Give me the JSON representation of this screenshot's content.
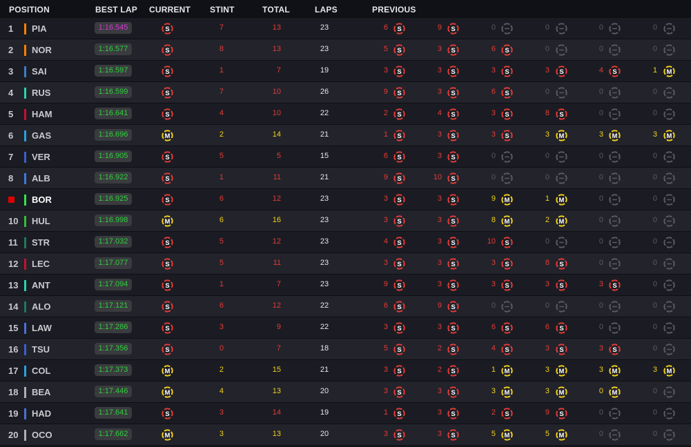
{
  "headers": {
    "position": "POSITION",
    "best_lap": "BEST LAP",
    "current": "CURRENT",
    "stint": "STINT",
    "total": "TOTAL",
    "laps": "LAPS",
    "previous": "PREVIOUS"
  },
  "colors": {
    "soft": "#e63b36",
    "medium": "#f3d21c",
    "none": "#5a5b62",
    "best_lap_green": "#2fd13d",
    "best_lap_purple": "#d13bd1",
    "player_marker": "#e00000"
  },
  "drivers": [
    {
      "pos": "1",
      "abbr": "PIA",
      "team_color": "#ff8000",
      "best": "1:16.545",
      "best_class": "purple",
      "current": "S",
      "stint": "7",
      "total": "13",
      "laps": "23",
      "prev": [
        [
          "6",
          "S"
        ],
        [
          "9",
          "S"
        ],
        [
          "0",
          "N"
        ],
        [
          "0",
          "N"
        ],
        [
          "0",
          "N"
        ],
        [
          "0",
          "N"
        ]
      ]
    },
    {
      "pos": "2",
      "abbr": "NOR",
      "team_color": "#ff8000",
      "best": "1:16.577",
      "best_class": "green",
      "current": "S",
      "stint": "8",
      "total": "13",
      "laps": "23",
      "prev": [
        [
          "5",
          "S"
        ],
        [
          "3",
          "S"
        ],
        [
          "6",
          "S"
        ],
        [
          "0",
          "N"
        ],
        [
          "0",
          "N"
        ],
        [
          "0",
          "N"
        ]
      ]
    },
    {
      "pos": "3",
      "abbr": "SAI",
      "team_color": "#3b7fc4",
      "best": "1:16.597",
      "best_class": "green",
      "current": "S",
      "stint": "1",
      "total": "7",
      "laps": "19",
      "prev": [
        [
          "3",
          "S"
        ],
        [
          "3",
          "S"
        ],
        [
          "3",
          "S"
        ],
        [
          "3",
          "S"
        ],
        [
          "4",
          "S"
        ],
        [
          "1",
          "M"
        ]
      ]
    },
    {
      "pos": "4",
      "abbr": "RUS",
      "team_color": "#27d6b0",
      "best": "1:16.599",
      "best_class": "green",
      "current": "S",
      "stint": "7",
      "total": "10",
      "laps": "26",
      "prev": [
        [
          "9",
          "S"
        ],
        [
          "3",
          "S"
        ],
        [
          "6",
          "S"
        ],
        [
          "0",
          "N"
        ],
        [
          "0",
          "N"
        ],
        [
          "0",
          "N"
        ]
      ]
    },
    {
      "pos": "5",
      "abbr": "HAM",
      "team_color": "#c8102e",
      "best": "1:16.641",
      "best_class": "green",
      "current": "S",
      "stint": "4",
      "total": "10",
      "laps": "22",
      "prev": [
        [
          "2",
          "S"
        ],
        [
          "4",
          "S"
        ],
        [
          "3",
          "S"
        ],
        [
          "8",
          "S"
        ],
        [
          "0",
          "N"
        ],
        [
          "0",
          "N"
        ]
      ]
    },
    {
      "pos": "6",
      "abbr": "GAS",
      "team_color": "#2aa1e0",
      "best": "1:16.696",
      "best_class": "green",
      "current": "M",
      "stint": "2",
      "total": "14",
      "laps": "21",
      "prev": [
        [
          "1",
          "S"
        ],
        [
          "3",
          "S"
        ],
        [
          "3",
          "S"
        ],
        [
          "3",
          "M"
        ],
        [
          "3",
          "M"
        ],
        [
          "3",
          "M"
        ]
      ]
    },
    {
      "pos": "7",
      "abbr": "VER",
      "team_color": "#3a5fcf",
      "best": "1:16.905",
      "best_class": "green",
      "current": "S",
      "stint": "5",
      "total": "5",
      "laps": "15",
      "prev": [
        [
          "6",
          "S"
        ],
        [
          "3",
          "S"
        ],
        [
          "0",
          "N"
        ],
        [
          "0",
          "N"
        ],
        [
          "0",
          "N"
        ],
        [
          "0",
          "N"
        ]
      ]
    },
    {
      "pos": "8",
      "abbr": "ALB",
      "team_color": "#3a7be0",
      "best": "1:16.922",
      "best_class": "green",
      "current": "S",
      "stint": "1",
      "total": "11",
      "laps": "21",
      "prev": [
        [
          "9",
          "S"
        ],
        [
          "10",
          "S"
        ],
        [
          "0",
          "N"
        ],
        [
          "0",
          "N"
        ],
        [
          "0",
          "N"
        ],
        [
          "0",
          "N"
        ]
      ]
    },
    {
      "pos": "9",
      "abbr": "BOR",
      "team_color": "#34e34a",
      "best": "1:16.925",
      "best_class": "green",
      "current": "S",
      "stint": "6",
      "total": "12",
      "laps": "23",
      "prev": [
        [
          "3",
          "S"
        ],
        [
          "3",
          "S"
        ],
        [
          "9",
          "M"
        ],
        [
          "1",
          "M"
        ],
        [
          "0",
          "N"
        ],
        [
          "0",
          "N"
        ]
      ],
      "player": true
    },
    {
      "pos": "10",
      "abbr": "HUL",
      "team_color": "#34c03a",
      "best": "1:16.998",
      "best_class": "green",
      "current": "M",
      "stint": "6",
      "total": "16",
      "laps": "23",
      "prev": [
        [
          "3",
          "S"
        ],
        [
          "3",
          "S"
        ],
        [
          "8",
          "M"
        ],
        [
          "2",
          "M"
        ],
        [
          "0",
          "N"
        ],
        [
          "0",
          "N"
        ]
      ]
    },
    {
      "pos": "11",
      "abbr": "STR",
      "team_color": "#1e7a5a",
      "best": "1:17.032",
      "best_class": "green",
      "current": "S",
      "stint": "5",
      "total": "12",
      "laps": "23",
      "prev": [
        [
          "4",
          "S"
        ],
        [
          "3",
          "S"
        ],
        [
          "10",
          "S"
        ],
        [
          "0",
          "N"
        ],
        [
          "0",
          "N"
        ],
        [
          "0",
          "N"
        ]
      ]
    },
    {
      "pos": "12",
      "abbr": "LEC",
      "team_color": "#c8102e",
      "best": "1:17.077",
      "best_class": "green",
      "current": "S",
      "stint": "5",
      "total": "11",
      "laps": "23",
      "prev": [
        [
          "3",
          "S"
        ],
        [
          "3",
          "S"
        ],
        [
          "3",
          "S"
        ],
        [
          "8",
          "S"
        ],
        [
          "0",
          "N"
        ],
        [
          "0",
          "N"
        ]
      ]
    },
    {
      "pos": "13",
      "abbr": "ANT",
      "team_color": "#27d6b0",
      "best": "1:17.094",
      "best_class": "green",
      "current": "S",
      "stint": "1",
      "total": "7",
      "laps": "23",
      "prev": [
        [
          "9",
          "S"
        ],
        [
          "3",
          "S"
        ],
        [
          "3",
          "S"
        ],
        [
          "3",
          "S"
        ],
        [
          "3",
          "S"
        ],
        [
          "0",
          "N"
        ]
      ]
    },
    {
      "pos": "14",
      "abbr": "ALO",
      "team_color": "#1e7a5a",
      "best": "1:17.121",
      "best_class": "green",
      "current": "S",
      "stint": "6",
      "total": "12",
      "laps": "22",
      "prev": [
        [
          "6",
          "S"
        ],
        [
          "9",
          "S"
        ],
        [
          "0",
          "N"
        ],
        [
          "0",
          "N"
        ],
        [
          "0",
          "N"
        ],
        [
          "0",
          "N"
        ]
      ]
    },
    {
      "pos": "15",
      "abbr": "LAW",
      "team_color": "#4a6fd6",
      "best": "1:17.286",
      "best_class": "green",
      "current": "S",
      "stint": "3",
      "total": "9",
      "laps": "22",
      "prev": [
        [
          "3",
          "S"
        ],
        [
          "3",
          "S"
        ],
        [
          "6",
          "S"
        ],
        [
          "6",
          "S"
        ],
        [
          "0",
          "N"
        ],
        [
          "0",
          "N"
        ]
      ]
    },
    {
      "pos": "16",
      "abbr": "TSU",
      "team_color": "#3a5fcf",
      "best": "1:17.356",
      "best_class": "green",
      "current": "S",
      "stint": "0",
      "total": "7",
      "laps": "18",
      "prev": [
        [
          "5",
          "S"
        ],
        [
          "2",
          "S"
        ],
        [
          "4",
          "S"
        ],
        [
          "3",
          "S"
        ],
        [
          "3",
          "S"
        ],
        [
          "0",
          "N"
        ]
      ]
    },
    {
      "pos": "17",
      "abbr": "COL",
      "team_color": "#2aa1e0",
      "best": "1:17.373",
      "best_class": "green",
      "current": "M",
      "stint": "2",
      "total": "15",
      "laps": "21",
      "prev": [
        [
          "3",
          "S"
        ],
        [
          "2",
          "S"
        ],
        [
          "1",
          "M"
        ],
        [
          "3",
          "M"
        ],
        [
          "3",
          "M"
        ],
        [
          "3",
          "M"
        ]
      ]
    },
    {
      "pos": "18",
      "abbr": "BEA",
      "team_color": "#b0b0b0",
      "best": "1:17.446",
      "best_class": "green",
      "current": "M",
      "stint": "4",
      "total": "13",
      "laps": "20",
      "prev": [
        [
          "3",
          "S"
        ],
        [
          "3",
          "S"
        ],
        [
          "3",
          "M"
        ],
        [
          "3",
          "M"
        ],
        [
          "0",
          "M"
        ],
        [
          "0",
          "N"
        ]
      ]
    },
    {
      "pos": "19",
      "abbr": "HAD",
      "team_color": "#4a6fd6",
      "best": "1:17.641",
      "best_class": "green",
      "current": "S",
      "stint": "3",
      "total": "14",
      "laps": "19",
      "prev": [
        [
          "1",
          "S"
        ],
        [
          "3",
          "S"
        ],
        [
          "2",
          "S"
        ],
        [
          "9",
          "S"
        ],
        [
          "0",
          "N"
        ],
        [
          "0",
          "N"
        ]
      ]
    },
    {
      "pos": "20",
      "abbr": "OCO",
      "team_color": "#b0b0b0",
      "best": "1:17.662",
      "best_class": "green",
      "current": "M",
      "stint": "3",
      "total": "13",
      "laps": "20",
      "prev": [
        [
          "3",
          "S"
        ],
        [
          "3",
          "S"
        ],
        [
          "5",
          "M"
        ],
        [
          "5",
          "M"
        ],
        [
          "0",
          "N"
        ],
        [
          "0",
          "N"
        ]
      ]
    }
  ]
}
